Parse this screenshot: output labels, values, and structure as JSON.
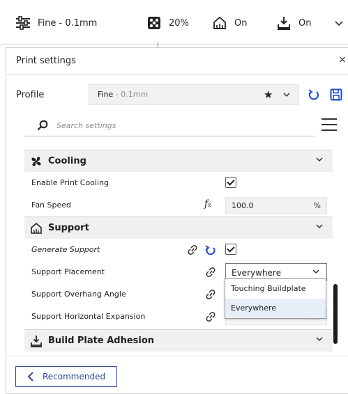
{
  "topbar": {
    "profile_name": "Fine - 0.1mm",
    "infill": "20%",
    "support": "On",
    "adhesion": "On",
    "icons": [
      "settings-sliders-icon",
      "infill-icon",
      "support-icon",
      "adhesion-icon",
      "chevron-down-icon"
    ]
  },
  "panel": {
    "title": "Print settings",
    "close_label": "×"
  },
  "profile": {
    "label": "Profile",
    "value_main": "Fine",
    "value_sub": " - 0.1mm",
    "star": "★"
  },
  "search": {
    "placeholder": "Search settings"
  },
  "categories": {
    "cooling": "Cooling",
    "support": "Support",
    "adhesion": "Build Plate Adhesion"
  },
  "settings": {
    "enable_print_cooling": {
      "label": "Enable Print Cooling",
      "checked": true
    },
    "fan_speed": {
      "label": "Fan Speed",
      "fx": "f",
      "value": "100.0",
      "unit": "%"
    },
    "generate_support": {
      "label": "Generate Support",
      "checked": true
    },
    "support_placement": {
      "label": "Support Placement",
      "value": "Everywhere"
    },
    "support_overhang_angle": {
      "label": "Support Overhang Angle"
    },
    "support_horizontal_expansion": {
      "label": "Support Horizontal Expansion",
      "unit": "mm"
    }
  },
  "dropdown": {
    "options": [
      "Touching Buildplate",
      "Everywhere"
    ],
    "selected": "Everywhere"
  },
  "footer": {
    "recommended_label": "Recommended"
  },
  "colors": {
    "accent": "#1f4cc7",
    "link_blue": "#2f4b8c"
  }
}
